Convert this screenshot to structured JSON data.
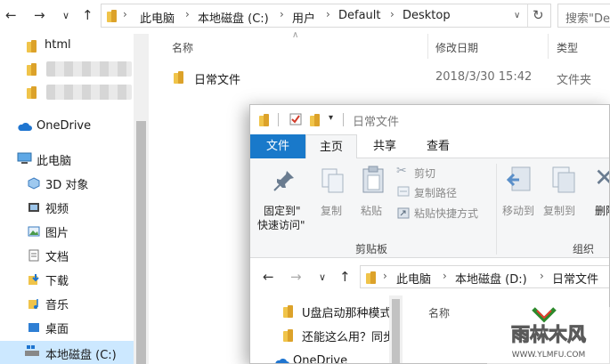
{
  "back_window": {
    "breadcrumb": [
      "此电脑",
      "本地磁盘 (C:)",
      "用户",
      "Default",
      "Desktop"
    ],
    "search_placeholder": "搜索\"De",
    "sidebar": {
      "html": "html",
      "onedrive": "OneDrive",
      "this_pc": "此电脑",
      "objects3d": "3D 对象",
      "videos": "视频",
      "pictures": "图片",
      "documents": "文档",
      "downloads": "下载",
      "music": "音乐",
      "desktop": "桌面",
      "drive_c": "本地磁盘 (C:)"
    },
    "columns": {
      "name": "名称",
      "modified": "修改日期",
      "type": "类型"
    },
    "rows": [
      {
        "name": "日常文件",
        "modified": "2018/3/30 15:42",
        "type": "文件夹"
      }
    ]
  },
  "front_window": {
    "title": "日常文件",
    "tabs": {
      "file": "文件",
      "home": "主页",
      "share": "共享",
      "view": "查看"
    },
    "ribbon": {
      "pin": "固定到\"",
      "pin2": "快速访问\"",
      "copy": "复制",
      "paste": "粘贴",
      "cut": "剪切",
      "copy_path": "复制路径",
      "paste_shortcut": "粘贴快捷方式",
      "clipboard_group": "剪贴板",
      "move_to": "移动到",
      "copy_to": "复制到",
      "delete": "删除",
      "organize_group": "组织"
    },
    "breadcrumb": [
      "此电脑",
      "本地磁盘 (D:)",
      "日常文件"
    ],
    "sidebar": {
      "item1": "U盘启动那种模式",
      "item2": "还能这么用？同步",
      "onedrive": "OneDrive"
    },
    "columns": {
      "name": "名称"
    }
  },
  "watermark": {
    "main": "雨林木风",
    "sub": "WWW.YLMFU.COM"
  },
  "colors": {
    "accent": "#1979ca",
    "folder": "#f0c44a",
    "selection": "#cce8ff"
  }
}
